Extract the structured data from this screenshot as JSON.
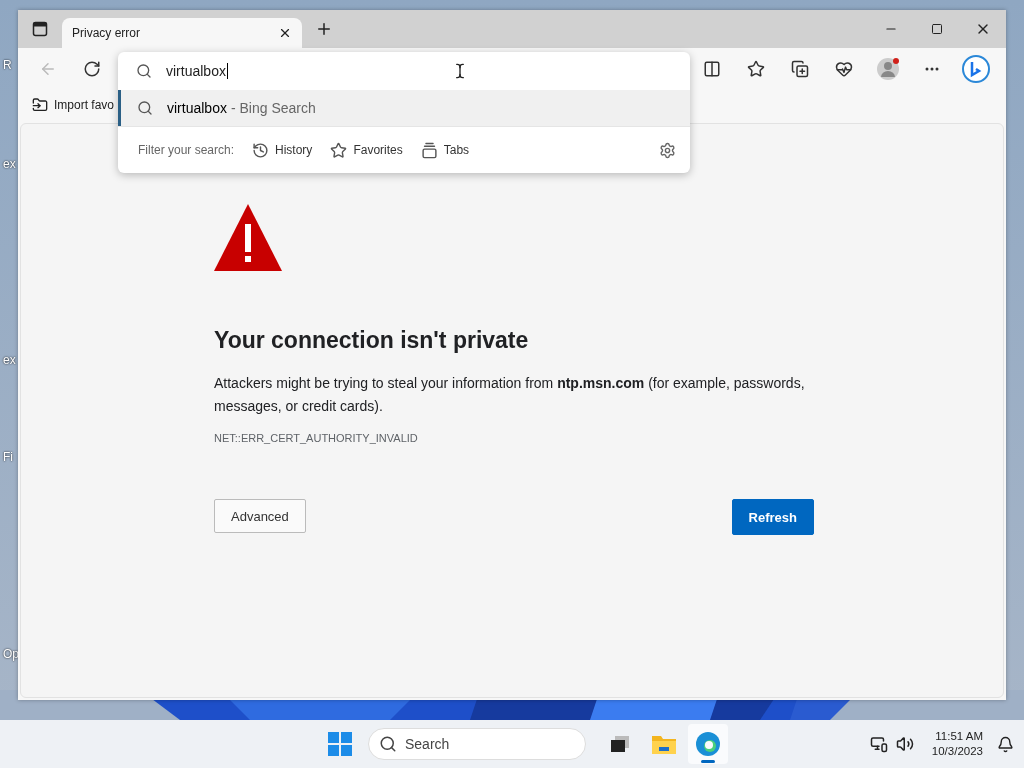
{
  "desktop_labels": [
    "R",
    "ex",
    "ex",
    "Fi",
    "Op"
  ],
  "browser": {
    "tabs": [
      {
        "title": "Privacy error",
        "selected": true
      }
    ],
    "favorites_bar": {
      "items": [
        "Import favo"
      ]
    },
    "address_dropdown": {
      "query": "virtualbox",
      "suggestions": [
        {
          "query": "virtualbox",
          "source": "- Bing Search",
          "selected": true
        }
      ],
      "filter_label": "Filter your search:",
      "filters": [
        {
          "kind": "history",
          "label": "History"
        },
        {
          "kind": "favorites",
          "label": "Favorites"
        },
        {
          "kind": "tabs",
          "label": "Tabs"
        }
      ]
    },
    "page": {
      "heading": "Your connection isn't private",
      "message": "Attackers might be trying to steal your information from **ntp.msn.com** (for example, passwords, messages, or credit cards).",
      "error_code": "NET::ERR_CERT_AUTHORITY_INVALID",
      "buttons": [
        {
          "kind": "secondary",
          "label": "Advanced"
        },
        {
          "kind": "primary",
          "label": "Refresh"
        }
      ]
    }
  },
  "taskbar": {
    "search_placeholder": "Search",
    "apps": [
      {
        "kind": "taskview",
        "selected": false
      },
      {
        "kind": "explorer",
        "selected": false
      },
      {
        "kind": "edge",
        "selected": true
      }
    ],
    "time": "11:51 AM",
    "date": "10/3/2023"
  }
}
